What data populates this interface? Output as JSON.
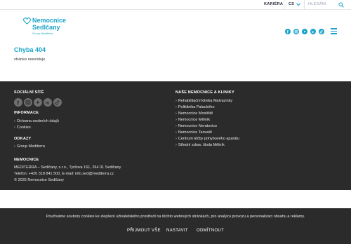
{
  "topbar": {
    "career": "KARIÉRA",
    "language": "CS",
    "search_placeholder": "HLEDÁNÍ"
  },
  "logo": {
    "line1": "Nemocnice",
    "line2": "Sedlčany",
    "sub": "Group Mediterra"
  },
  "header_icons": [
    "facebook-icon",
    "instagram-icon",
    "youtube-icon",
    "linkedin-icon",
    "tiktok-icon"
  ],
  "main": {
    "title": "Chyba 404",
    "text": "stránka neexistuje"
  },
  "footer": {
    "social_heading": "SOCIÁLNÍ SÍTĚ",
    "info_heading": "INFORMACE",
    "info_links": [
      "Ochrana osobních údajů",
      "Cookies"
    ],
    "links_heading": "ODKAZY",
    "links": [
      "Group Mediterra"
    ],
    "hospital_heading": "NEMOCNICE",
    "company": "MEDITERRA – Sedlčany, s.r.o., Tyršova 161, 264 01 Sedlčany",
    "contact": "Telefon: +420 318 841 500, E-mail: info.sed@mediterra.cz",
    "copyright": "© 2025 Nemocnice Sedlčany",
    "clinics_heading": "NAŠE NEMOCNICE A KLINIKY",
    "clinics": [
      "Rehabilitační klinika Malvazinky",
      "Poliklinika Palackého",
      "Nemocnice Mostiště",
      "Nemocnice Mělník",
      "Nemocnice Neratovice",
      "Nemocnice Tanvald",
      "Centrum léčby pohybového aparátu",
      "Střední zdrav. škola Mělník"
    ]
  },
  "cookie": {
    "text": "Používáme soubory cookies ke zlepšení uživatelského prostředí na těchto webových stránkách, pro analýzu provozu a personalizaci obsahu a reklamy.",
    "accept_all": "PŘIJMOUT VŠE",
    "settings": "NASTAVIT",
    "reject": "ODMÍTNOUT"
  },
  "colors": {
    "brand": "#1aa3c8",
    "footer_bg": "#2b2b2b"
  }
}
